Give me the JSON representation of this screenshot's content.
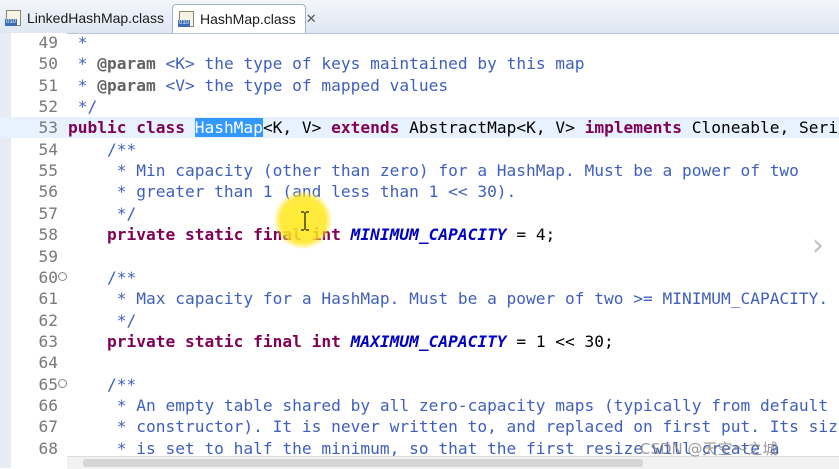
{
  "tabs": [
    {
      "label": "LinkedHashMap.class",
      "active": false,
      "icon": "class-file-icon"
    },
    {
      "label": "HashMap.class",
      "active": true,
      "icon": "class-file-icon",
      "close": "✕"
    }
  ],
  "editor": {
    "lines": [
      {
        "num": "49",
        "segments": [
          {
            "t": "cm",
            "s": " *"
          }
        ]
      },
      {
        "num": "50",
        "segments": [
          {
            "t": "cm",
            "s": " * "
          },
          {
            "t": "ann",
            "s": "@param"
          },
          {
            "t": "cm",
            "s": " <K> the type of keys maintained by this map"
          }
        ]
      },
      {
        "num": "51",
        "segments": [
          {
            "t": "cm",
            "s": " * "
          },
          {
            "t": "ann",
            "s": "@param"
          },
          {
            "t": "cm",
            "s": " <V> the type of mapped values"
          }
        ]
      },
      {
        "num": "52",
        "segments": [
          {
            "t": "cm",
            "s": " */"
          }
        ]
      },
      {
        "num": "53",
        "highlight": true,
        "segments": [
          {
            "t": "kw",
            "s": "public class "
          },
          {
            "t": "sel",
            "s": "HashMap"
          },
          {
            "t": "",
            "s": "<K, V> "
          },
          {
            "t": "kw",
            "s": "extends"
          },
          {
            "t": "",
            "s": " AbstractMap<K, V> "
          },
          {
            "t": "kw",
            "s": "implements"
          },
          {
            "t": "",
            "s": " Cloneable, Seria"
          }
        ]
      },
      {
        "num": "54",
        "segments": [
          {
            "t": "cm",
            "s": "    /**"
          }
        ]
      },
      {
        "num": "55",
        "segments": [
          {
            "t": "cm",
            "s": "     * Min capacity (other than zero) for a HashMap. Must be a power of two"
          }
        ]
      },
      {
        "num": "56",
        "segments": [
          {
            "t": "cm",
            "s": "     * greater than 1 (and less than 1 << 30)."
          }
        ]
      },
      {
        "num": "57",
        "segments": [
          {
            "t": "cm",
            "s": "     */"
          }
        ]
      },
      {
        "num": "58",
        "segments": [
          {
            "t": "kw",
            "s": "    private static final int "
          },
          {
            "t": "fld",
            "s": "MINIMUM_CAPACITY"
          },
          {
            "t": "",
            "s": " = 4;"
          }
        ]
      },
      {
        "num": "59",
        "segments": [
          {
            "t": "",
            "s": ""
          }
        ]
      },
      {
        "num": "60",
        "fold": "⊖",
        "segments": [
          {
            "t": "cm",
            "s": "    /**"
          }
        ]
      },
      {
        "num": "61",
        "segments": [
          {
            "t": "cm",
            "s": "     * Max capacity for a HashMap. Must be a power of two >= MINIMUM_CAPACITY."
          }
        ]
      },
      {
        "num": "62",
        "segments": [
          {
            "t": "cm",
            "s": "     */"
          }
        ]
      },
      {
        "num": "63",
        "segments": [
          {
            "t": "kw",
            "s": "    private static final int "
          },
          {
            "t": "fld",
            "s": "MAXIMUM_CAPACITY"
          },
          {
            "t": "",
            "s": " = 1 << 30;"
          }
        ]
      },
      {
        "num": "64",
        "segments": [
          {
            "t": "",
            "s": ""
          }
        ]
      },
      {
        "num": "65",
        "fold": "⊖",
        "segments": [
          {
            "t": "cm",
            "s": "    /**"
          }
        ]
      },
      {
        "num": "66",
        "segments": [
          {
            "t": "cm",
            "s": "     * An empty table shared by all zero-capacity maps (typically from default"
          }
        ]
      },
      {
        "num": "67",
        "segments": [
          {
            "t": "cm",
            "s": "     * constructor). It is never written to, and replaced on first put. Its size"
          }
        ]
      },
      {
        "num": "68",
        "segments": [
          {
            "t": "cm",
            "s": "     * is set to half the minimum, so that the first resize will create a"
          }
        ]
      }
    ]
  },
  "nav": {
    "next_icon": "chevron-right-icon",
    "next_glyph": "›"
  },
  "watermark": "CSDN @天空～之城"
}
